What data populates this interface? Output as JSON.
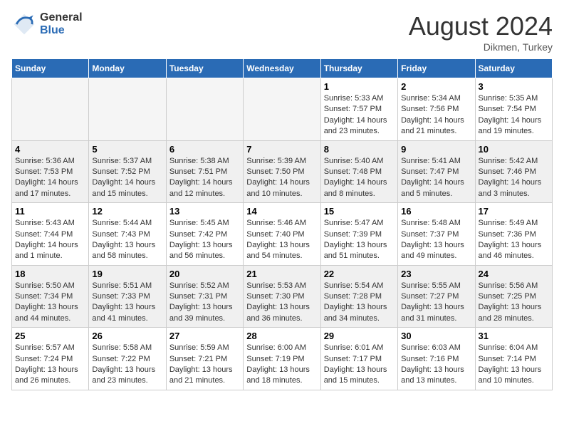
{
  "header": {
    "logo_general": "General",
    "logo_blue": "Blue",
    "month_year": "August 2024",
    "location": "Dikmen, Turkey"
  },
  "days_of_week": [
    "Sunday",
    "Monday",
    "Tuesday",
    "Wednesday",
    "Thursday",
    "Friday",
    "Saturday"
  ],
  "weeks": [
    {
      "days": [
        {
          "number": "",
          "info": ""
        },
        {
          "number": "",
          "info": ""
        },
        {
          "number": "",
          "info": ""
        },
        {
          "number": "",
          "info": ""
        },
        {
          "number": "1",
          "info": "Sunrise: 5:33 AM\nSunset: 7:57 PM\nDaylight: 14 hours and 23 minutes."
        },
        {
          "number": "2",
          "info": "Sunrise: 5:34 AM\nSunset: 7:56 PM\nDaylight: 14 hours and 21 minutes."
        },
        {
          "number": "3",
          "info": "Sunrise: 5:35 AM\nSunset: 7:54 PM\nDaylight: 14 hours and 19 minutes."
        }
      ]
    },
    {
      "days": [
        {
          "number": "4",
          "info": "Sunrise: 5:36 AM\nSunset: 7:53 PM\nDaylight: 14 hours and 17 minutes."
        },
        {
          "number": "5",
          "info": "Sunrise: 5:37 AM\nSunset: 7:52 PM\nDaylight: 14 hours and 15 minutes."
        },
        {
          "number": "6",
          "info": "Sunrise: 5:38 AM\nSunset: 7:51 PM\nDaylight: 14 hours and 12 minutes."
        },
        {
          "number": "7",
          "info": "Sunrise: 5:39 AM\nSunset: 7:50 PM\nDaylight: 14 hours and 10 minutes."
        },
        {
          "number": "8",
          "info": "Sunrise: 5:40 AM\nSunset: 7:48 PM\nDaylight: 14 hours and 8 minutes."
        },
        {
          "number": "9",
          "info": "Sunrise: 5:41 AM\nSunset: 7:47 PM\nDaylight: 14 hours and 5 minutes."
        },
        {
          "number": "10",
          "info": "Sunrise: 5:42 AM\nSunset: 7:46 PM\nDaylight: 14 hours and 3 minutes."
        }
      ]
    },
    {
      "days": [
        {
          "number": "11",
          "info": "Sunrise: 5:43 AM\nSunset: 7:44 PM\nDaylight: 14 hours and 1 minute."
        },
        {
          "number": "12",
          "info": "Sunrise: 5:44 AM\nSunset: 7:43 PM\nDaylight: 13 hours and 58 minutes."
        },
        {
          "number": "13",
          "info": "Sunrise: 5:45 AM\nSunset: 7:42 PM\nDaylight: 13 hours and 56 minutes."
        },
        {
          "number": "14",
          "info": "Sunrise: 5:46 AM\nSunset: 7:40 PM\nDaylight: 13 hours and 54 minutes."
        },
        {
          "number": "15",
          "info": "Sunrise: 5:47 AM\nSunset: 7:39 PM\nDaylight: 13 hours and 51 minutes."
        },
        {
          "number": "16",
          "info": "Sunrise: 5:48 AM\nSunset: 7:37 PM\nDaylight: 13 hours and 49 minutes."
        },
        {
          "number": "17",
          "info": "Sunrise: 5:49 AM\nSunset: 7:36 PM\nDaylight: 13 hours and 46 minutes."
        }
      ]
    },
    {
      "days": [
        {
          "number": "18",
          "info": "Sunrise: 5:50 AM\nSunset: 7:34 PM\nDaylight: 13 hours and 44 minutes."
        },
        {
          "number": "19",
          "info": "Sunrise: 5:51 AM\nSunset: 7:33 PM\nDaylight: 13 hours and 41 minutes."
        },
        {
          "number": "20",
          "info": "Sunrise: 5:52 AM\nSunset: 7:31 PM\nDaylight: 13 hours and 39 minutes."
        },
        {
          "number": "21",
          "info": "Sunrise: 5:53 AM\nSunset: 7:30 PM\nDaylight: 13 hours and 36 minutes."
        },
        {
          "number": "22",
          "info": "Sunrise: 5:54 AM\nSunset: 7:28 PM\nDaylight: 13 hours and 34 minutes."
        },
        {
          "number": "23",
          "info": "Sunrise: 5:55 AM\nSunset: 7:27 PM\nDaylight: 13 hours and 31 minutes."
        },
        {
          "number": "24",
          "info": "Sunrise: 5:56 AM\nSunset: 7:25 PM\nDaylight: 13 hours and 28 minutes."
        }
      ]
    },
    {
      "days": [
        {
          "number": "25",
          "info": "Sunrise: 5:57 AM\nSunset: 7:24 PM\nDaylight: 13 hours and 26 minutes."
        },
        {
          "number": "26",
          "info": "Sunrise: 5:58 AM\nSunset: 7:22 PM\nDaylight: 13 hours and 23 minutes."
        },
        {
          "number": "27",
          "info": "Sunrise: 5:59 AM\nSunset: 7:21 PM\nDaylight: 13 hours and 21 minutes."
        },
        {
          "number": "28",
          "info": "Sunrise: 6:00 AM\nSunset: 7:19 PM\nDaylight: 13 hours and 18 minutes."
        },
        {
          "number": "29",
          "info": "Sunrise: 6:01 AM\nSunset: 7:17 PM\nDaylight: 13 hours and 15 minutes."
        },
        {
          "number": "30",
          "info": "Sunrise: 6:03 AM\nSunset: 7:16 PM\nDaylight: 13 hours and 13 minutes."
        },
        {
          "number": "31",
          "info": "Sunrise: 6:04 AM\nSunset: 7:14 PM\nDaylight: 13 hours and 10 minutes."
        }
      ]
    }
  ]
}
